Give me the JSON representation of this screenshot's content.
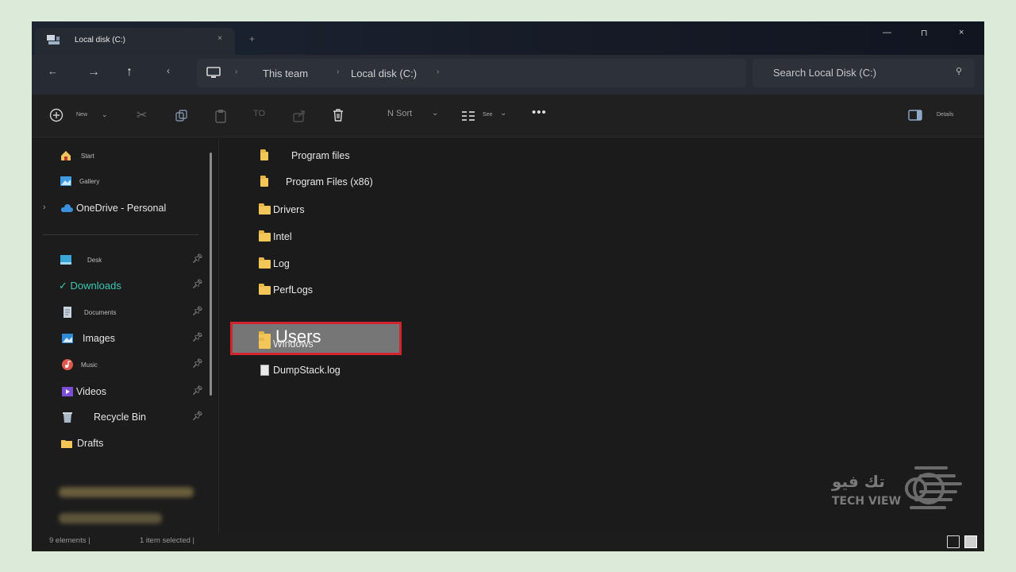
{
  "window": {
    "tab_title": "Local disk (C:)",
    "tab_close": "×",
    "new_tab": "+",
    "controls": {
      "minimize": "—",
      "maximize": "⊓",
      "close": "×"
    }
  },
  "address": {
    "back": "←",
    "forward": "→",
    "up": "↑",
    "refresh": "‹",
    "crumbs": [
      "This team",
      "Local disk (C:)"
    ],
    "search_placeholder": "Search Local Disk (C:)"
  },
  "commands": {
    "new_label": "New",
    "rename_label": "TO",
    "sort_label": "N Sort",
    "view_label": "See",
    "more": "•••",
    "details_label": "Details"
  },
  "sidebar": {
    "top_items": [
      {
        "label": "Start",
        "icon": "home-icon"
      },
      {
        "label": "Gallery",
        "icon": "gallery-icon"
      },
      {
        "label": "OneDrive - Personal",
        "icon": "onedrive-icon"
      }
    ],
    "pinned": [
      {
        "label": "Desk",
        "icon": "desktop-icon"
      },
      {
        "label": "✓ Downloads",
        "icon": "downloads-icon"
      },
      {
        "label": "Documents",
        "icon": "documents-icon"
      },
      {
        "label": "Images",
        "icon": "images-icon"
      },
      {
        "label": "Music",
        "icon": "music-icon"
      },
      {
        "label": "Videos",
        "icon": "videos-icon"
      },
      {
        "label": "Recycle Bin",
        "icon": "recycle-bin-icon"
      },
      {
        "label": "Drafts",
        "icon": "folder-icon"
      }
    ]
  },
  "files": [
    {
      "name": "Program files",
      "type": "folder"
    },
    {
      "name": "Program Files (x86)",
      "type": "folder"
    },
    {
      "name": "Drivers",
      "type": "folder"
    },
    {
      "name": "Intel",
      "type": "folder"
    },
    {
      "name": "Log",
      "type": "folder"
    },
    {
      "name": "PerfLogs",
      "type": "folder"
    },
    {
      "name": "Users",
      "type": "folder",
      "selected": true
    },
    {
      "name": "Windows",
      "type": "folder"
    },
    {
      "name": "DumpStack.log",
      "type": "file"
    }
  ],
  "status": {
    "count": "9 elements |",
    "selected": "1 item selected |"
  },
  "colors": {
    "accent_highlight": "#d2242f",
    "folder": "#f2c757",
    "selected_bg": "#767676"
  }
}
